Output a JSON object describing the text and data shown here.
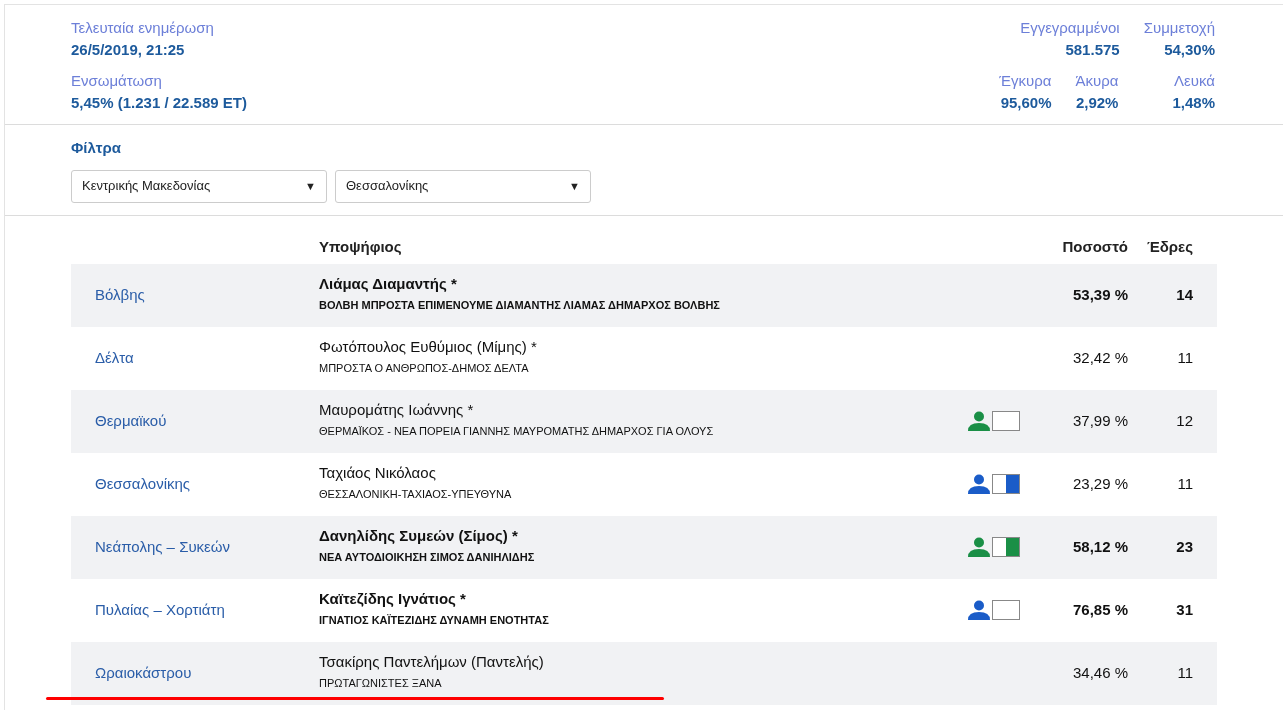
{
  "summary_left": [
    {
      "label": "Τελευταία ενημέρωση",
      "value": "26/5/2019, 21:25"
    },
    {
      "label": "Ενσωμάτωση",
      "value": "5,45% (1.231 / 22.589 ΕΤ)"
    }
  ],
  "summary_right": [
    [
      {
        "label": "Εγγεγραμμένοι",
        "value": "581.575"
      },
      {
        "label": "Συμμετοχή",
        "value": "54,30%"
      }
    ],
    [
      {
        "label": "Έγκυρα",
        "value": "95,60%"
      },
      {
        "label": "Άκυρα",
        "value": "2,92%"
      },
      {
        "label": "Λευκά",
        "value": "1,48%"
      }
    ]
  ],
  "filters": {
    "title": "Φίλτρα",
    "selects": [
      {
        "value": "Κεντρικής Μακεδονίας",
        "arrow": "▼"
      },
      {
        "value": "Θεσσαλονίκης",
        "arrow": "▼"
      }
    ]
  },
  "table": {
    "columns": [
      "Υποψήφιος",
      "Ποσοστό",
      "Έδρες"
    ],
    "rows": [
      {
        "municipality": "Βόλβης",
        "candidate": "Λιάμας Διαμαντής *",
        "party": "ΒΟΛΒΗ ΜΠΡΟΣΤΑ ΕΠΙΜΕΝΟΥΜΕ ΔΙΑΜΑΝΤΗΣ ΛΙΑΜΑΣ ΔΗΜΑΡΧΟΣ ΒΟΛΒΗΣ",
        "elected": true,
        "percent": "53,39 %",
        "seats": "14"
      },
      {
        "municipality": "Δέλτα",
        "candidate": "Φωτόπουλος Ευθύμιος (Μίμης) *",
        "party": "ΜΠΡΟΣΤΑ Ο ΑΝΘΡΩΠΟΣ-ΔΗΜΟΣ ΔΕΛΤΑ",
        "elected": false,
        "percent": "32,42 %",
        "seats": "11"
      },
      {
        "municipality": "Θερμαϊκού",
        "candidate": "Μαυρομάτης Ιωάννης *",
        "party": "ΘΕΡΜΑΪΚΟΣ - ΝΕΑ ΠΟΡΕΙΑ ΓΙΑΝΝΗΣ ΜΑΥΡΟΜΑΤΗΣ ΔΗΜΑΡΧΟΣ ΓΙΑ ΟΛΟΥΣ",
        "elected": false,
        "percent": "37,99 %",
        "seats": "12",
        "color": "#1a8f46",
        "filled": false
      },
      {
        "municipality": "Θεσσαλονίκης",
        "candidate": "Ταχιάος Νικόλαος",
        "party": "ΘΕΣΣΑΛΟΝΙΚΗ-ΤΑΧΙΑΟΣ-ΥΠΕΥΘΥΝΑ",
        "elected": false,
        "percent": "23,29 %",
        "seats": "11",
        "color": "#1a5cc8",
        "filled": true
      },
      {
        "municipality": "Νεάπολης – Συκεών",
        "candidate": "Δανηλίδης Συμεών (Σίμος) *",
        "party": "ΝΕΑ ΑΥΤΟΔΙΟΙΚΗΣΗ ΣΙΜΟΣ ΔΑΝΙΗΛΙΔΗΣ",
        "elected": true,
        "percent": "58,12 %",
        "seats": "23",
        "color": "#1a8f46",
        "filled": true
      },
      {
        "municipality": "Πυλαίας – Χορτιάτη",
        "candidate": "Καϊτεζίδης Ιγνάτιος *",
        "party": "ΙΓΝΑΤΙΟΣ ΚΑΪΤΕΖΙΔΗΣ ΔΥΝΑΜΗ ΕΝΟΤΗΤΑΣ",
        "elected": true,
        "percent": "76,85 %",
        "seats": "31",
        "color": "#1a5cc8",
        "filled": false
      },
      {
        "municipality": "Ωραιοκάστρου",
        "candidate": "Τσακίρης Παντελήμων (Παντελής)",
        "party": "ΠΡΩΤΑΓΩΝΙΣΤΕΣ ΞΑΝΑ",
        "elected": false,
        "percent": "34,46 %",
        "seats": "11"
      }
    ]
  }
}
